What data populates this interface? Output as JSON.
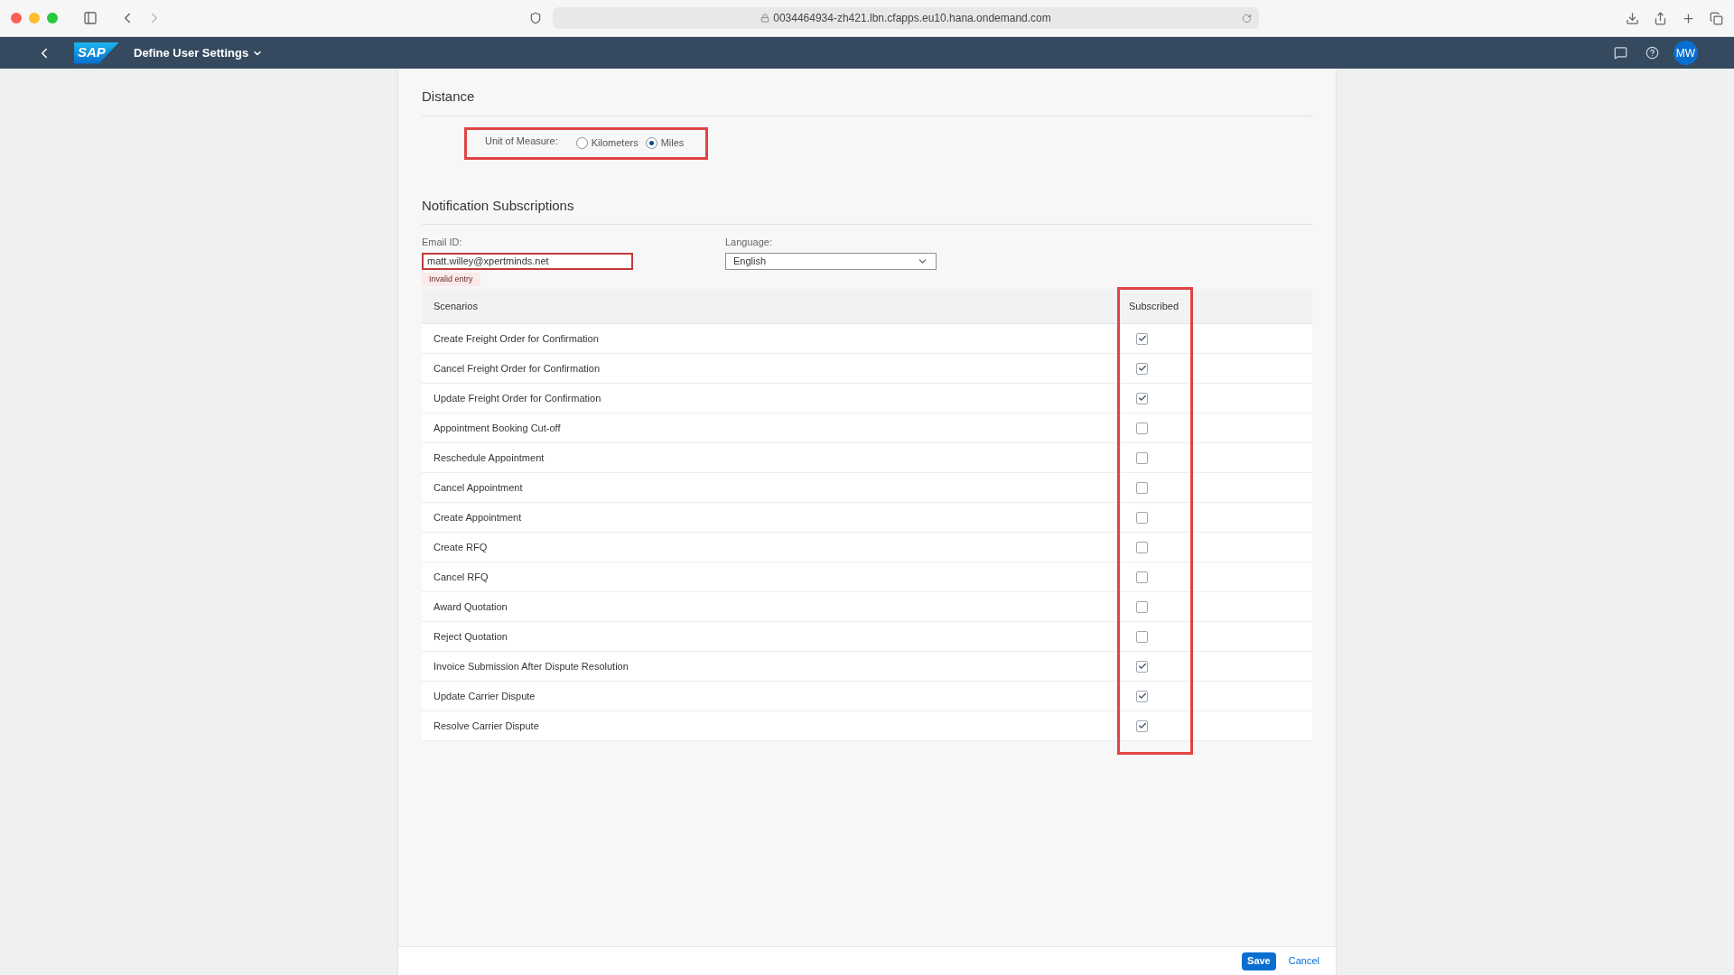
{
  "browser": {
    "url": "0034464934-zh421.lbn.cfapps.eu10.hana.ondemand.com"
  },
  "shell": {
    "logo": "SAP",
    "title": "Define User Settings",
    "avatar": "MW"
  },
  "distance": {
    "title": "Distance",
    "label": "Unit of Measure:",
    "options": [
      {
        "label": "Kilometers",
        "selected": false
      },
      {
        "label": "Miles",
        "selected": true
      }
    ]
  },
  "notifications": {
    "title": "Notification Subscriptions",
    "email": {
      "label": "Email ID:",
      "value": "matt.willey@xpertminds.net",
      "error": "Invalid entry"
    },
    "language": {
      "label": "Language:",
      "value": "English"
    },
    "table": {
      "columns": [
        "Scenarios",
        "Subscribed"
      ],
      "rows": [
        {
          "scenario": "Create Freight Order for Confirmation",
          "checked": true
        },
        {
          "scenario": "Cancel Freight Order for Confirmation",
          "checked": true
        },
        {
          "scenario": "Update Freight Order for Confirmation",
          "checked": true
        },
        {
          "scenario": "Appointment Booking Cut-off",
          "checked": false
        },
        {
          "scenario": "Reschedule Appointment",
          "checked": false
        },
        {
          "scenario": "Cancel Appointment",
          "checked": false
        },
        {
          "scenario": "Create Appointment",
          "checked": false
        },
        {
          "scenario": "Create RFQ",
          "checked": false
        },
        {
          "scenario": "Cancel RFQ",
          "checked": false
        },
        {
          "scenario": "Award Quotation",
          "checked": false
        },
        {
          "scenario": "Reject Quotation",
          "checked": false
        },
        {
          "scenario": "Invoice Submission After Dispute Resolution",
          "checked": true
        },
        {
          "scenario": "Update Carrier Dispute",
          "checked": true
        },
        {
          "scenario": "Resolve Carrier Dispute",
          "checked": true
        }
      ]
    }
  },
  "footer": {
    "buttons": [
      "Save",
      "Cancel"
    ]
  }
}
